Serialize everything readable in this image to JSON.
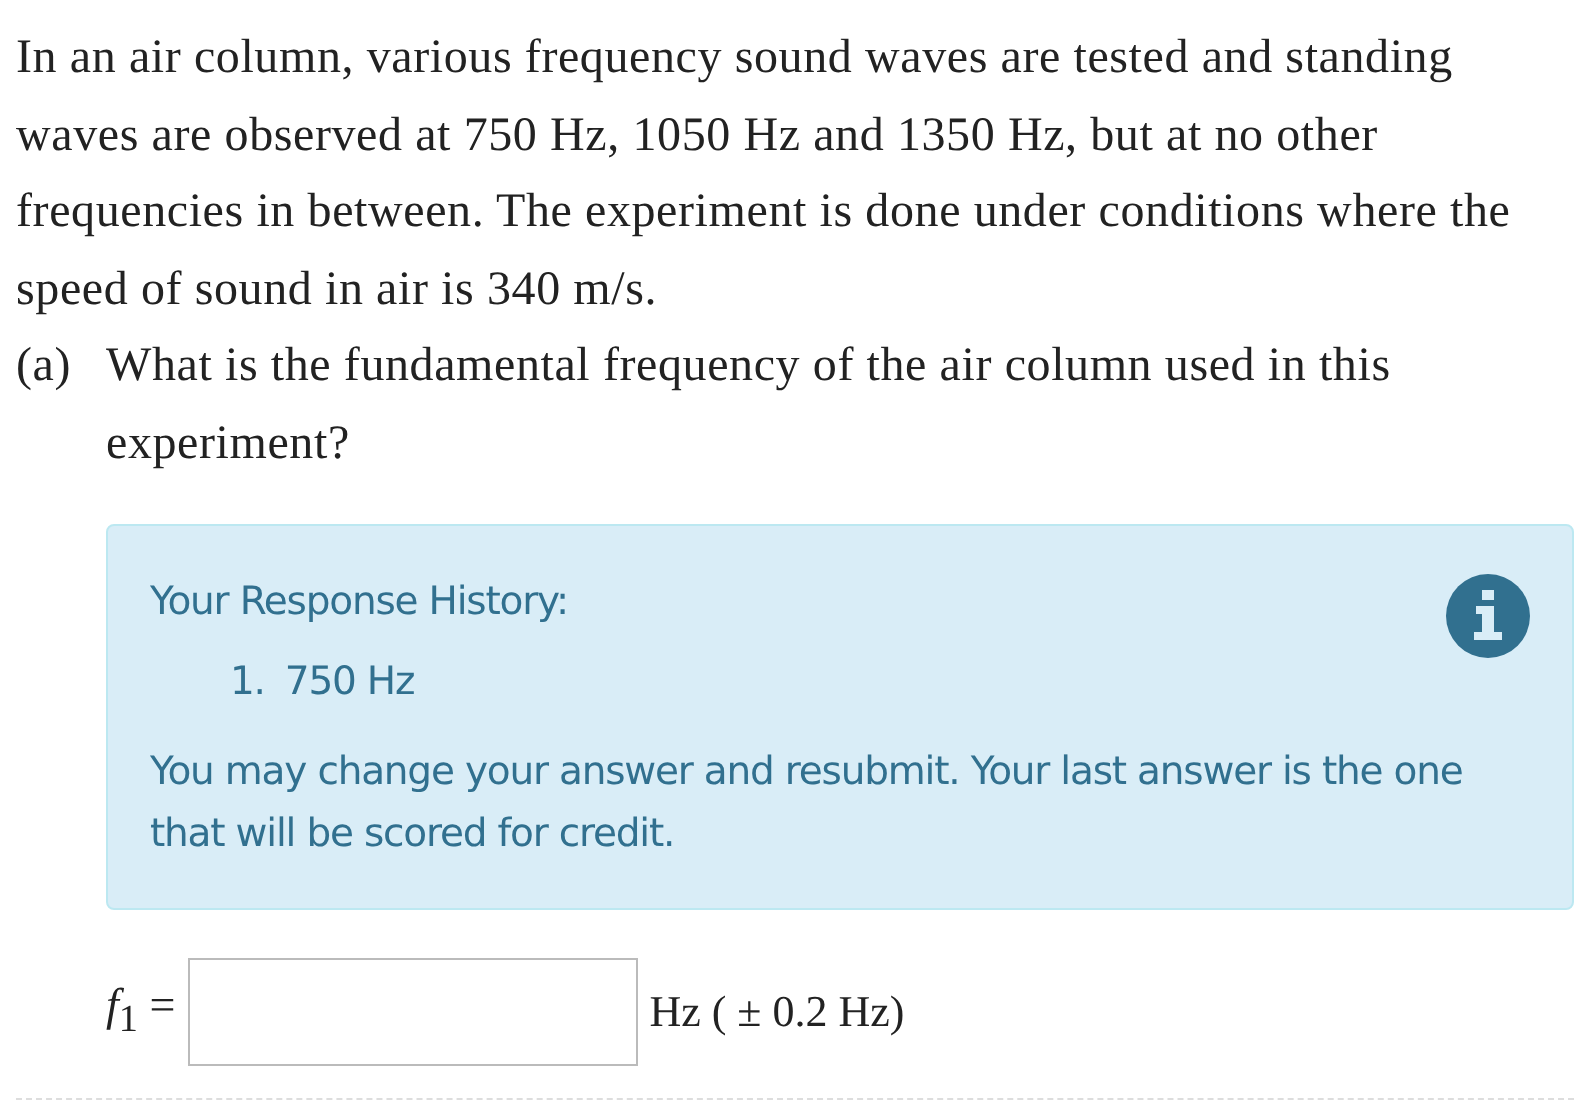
{
  "problem": {
    "statement": "In an air column, various frequency sound waves are tested and standing waves are observed at 750 Hz, 1050 Hz and 1350 Hz, but at no other frequencies in between. The experiment is done under conditions where the speed of sound in air is 340 m/s."
  },
  "part": {
    "label": "(a)",
    "question": "What is the fundamental frequency of the air column used in this experiment?"
  },
  "history": {
    "title": "Your Response History:",
    "responses": [
      {
        "number": "1.",
        "text": "750 Hz"
      }
    ],
    "note": "You may change your answer and resubmit. Your last answer is the one that will be scored for credit."
  },
  "answer": {
    "label": "*f*$_{1}$ =",
    "units": "Hz ( ± 0.2 Hz)"
  }
}
